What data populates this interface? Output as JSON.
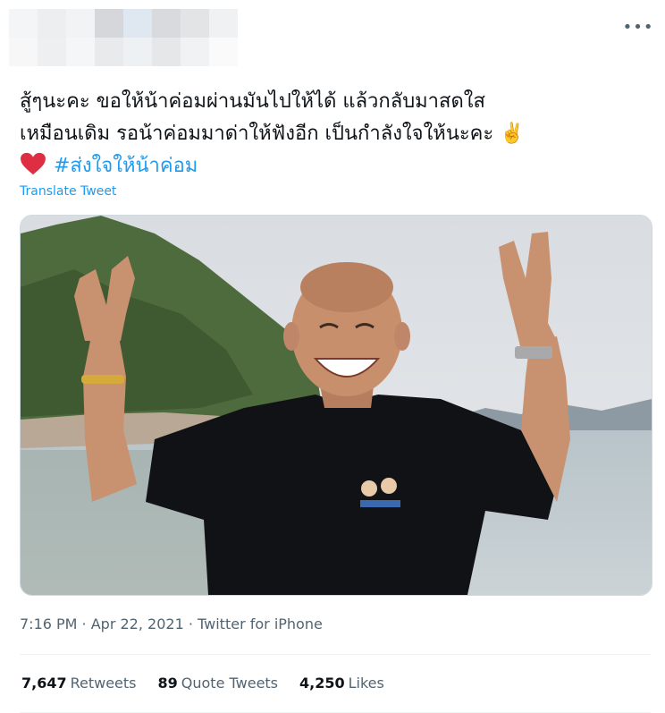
{
  "tweet": {
    "text_line1": "สู้ๆนะคะ ขอให้น้าค่อมผ่านมันไปให้ได้ แล้วกลับมาสดใส",
    "text_line2": "เหมือนเดิม รอน้าค่อมมาด่าให้ฟังอีก เป็นกำลังใจให้นะคะ",
    "victory_emoji": "✌️",
    "heart_icon": "red-heart-icon",
    "hashtag": "#ส่งใจให้น้าค่อม",
    "translate_label": "Translate Tweet",
    "more_icon": "more-icon"
  },
  "meta": {
    "time": "7:16 PM",
    "separator1": " · ",
    "date": "Apr 22, 2021",
    "separator2": " · ",
    "source": "Twitter for iPhone"
  },
  "stats": {
    "retweets_count": "7,647",
    "retweets_label": "Retweets",
    "quotes_count": "89",
    "quotes_label": "Quote Tweets",
    "likes_count": "4,250",
    "likes_label": "Likes"
  },
  "colors": {
    "accent": "#1d9bf0",
    "muted": "#536471",
    "heart": "#e0245e"
  }
}
